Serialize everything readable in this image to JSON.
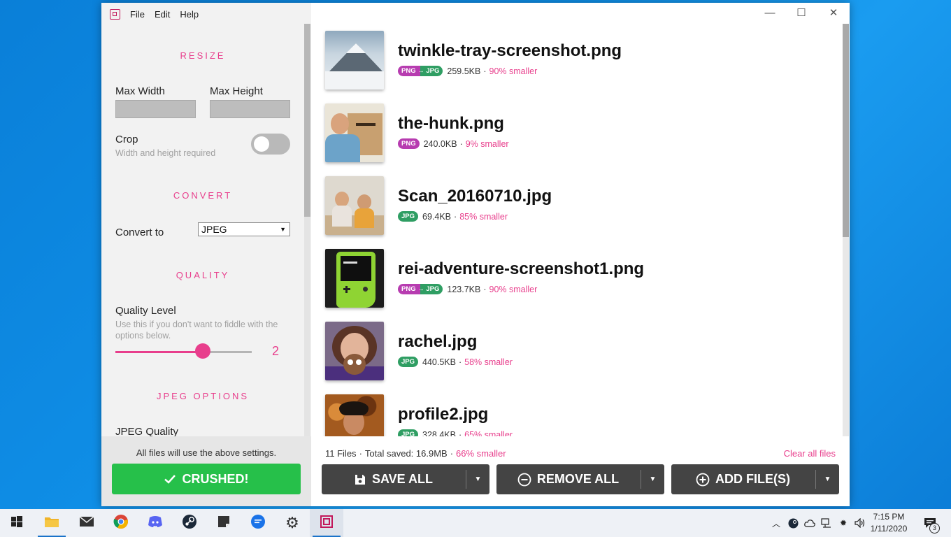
{
  "menu": [
    "File",
    "Edit",
    "Help"
  ],
  "resize": {
    "title": "RESIZE",
    "max_width_label": "Max Width",
    "max_height_label": "Max Height",
    "crop_label": "Crop",
    "crop_hint": "Width and height required"
  },
  "convert": {
    "title": "CONVERT",
    "label": "Convert to",
    "selected": "JPEG"
  },
  "quality": {
    "title": "QUALITY",
    "label": "Quality Level",
    "hint": "Use this if you don't want to fiddle with the options below.",
    "value": "2",
    "level_fraction": 0.64
  },
  "jpeg": {
    "title": "JPEG OPTIONS",
    "quality_label": "JPEG Quality"
  },
  "sidebar_footer": {
    "note": "All files will use the above settings.",
    "crushed_label": "CRUSHED!"
  },
  "window_controls": {
    "minimize": "—",
    "maximize": "☐",
    "close": "✕"
  },
  "files": [
    {
      "name": "twinkle-tray-screenshot.png",
      "badge": "PNG → JPG",
      "badge_type": "conv",
      "size": "259.5KB",
      "saved": "90% smaller",
      "thumb": "mountain"
    },
    {
      "name": "the-hunk.png",
      "badge": "PNG",
      "badge_type": "png",
      "size": "240.0KB",
      "saved": "9% smaller",
      "thumb": "hunk"
    },
    {
      "name": "Scan_20160710.jpg",
      "badge": "JPG",
      "badge_type": "jpg",
      "size": "69.4KB",
      "saved": "85% smaller",
      "thumb": "kids"
    },
    {
      "name": "rei-adventure-screenshot1.png",
      "badge": "PNG → JPG",
      "badge_type": "conv",
      "size": "123.7KB",
      "saved": "90% smaller",
      "thumb": "gameboy"
    },
    {
      "name": "rachel.jpg",
      "badge": "JPG",
      "badge_type": "jpg",
      "size": "440.5KB",
      "saved": "58% smaller",
      "thumb": "rachel"
    },
    {
      "name": "profile2.jpg",
      "badge": "JPG",
      "badge_type": "jpg",
      "size": "328.4KB",
      "saved": "65% smaller",
      "thumb": "profile"
    }
  ],
  "footer": {
    "file_count": "11 Files",
    "total_saved": "Total saved: 16.9MB",
    "total_pct": "66% smaller",
    "clear_label": "Clear all files",
    "save_all": "SAVE ALL",
    "remove_all": "REMOVE ALL",
    "add_files": "ADD FILE(S)"
  },
  "taskbar": {
    "time": "7:15 PM",
    "date": "1/11/2020",
    "notification_count": "3"
  },
  "colors": {
    "accent": "#e83e8c",
    "success": "#26c04a",
    "button_dark": "#444444"
  }
}
